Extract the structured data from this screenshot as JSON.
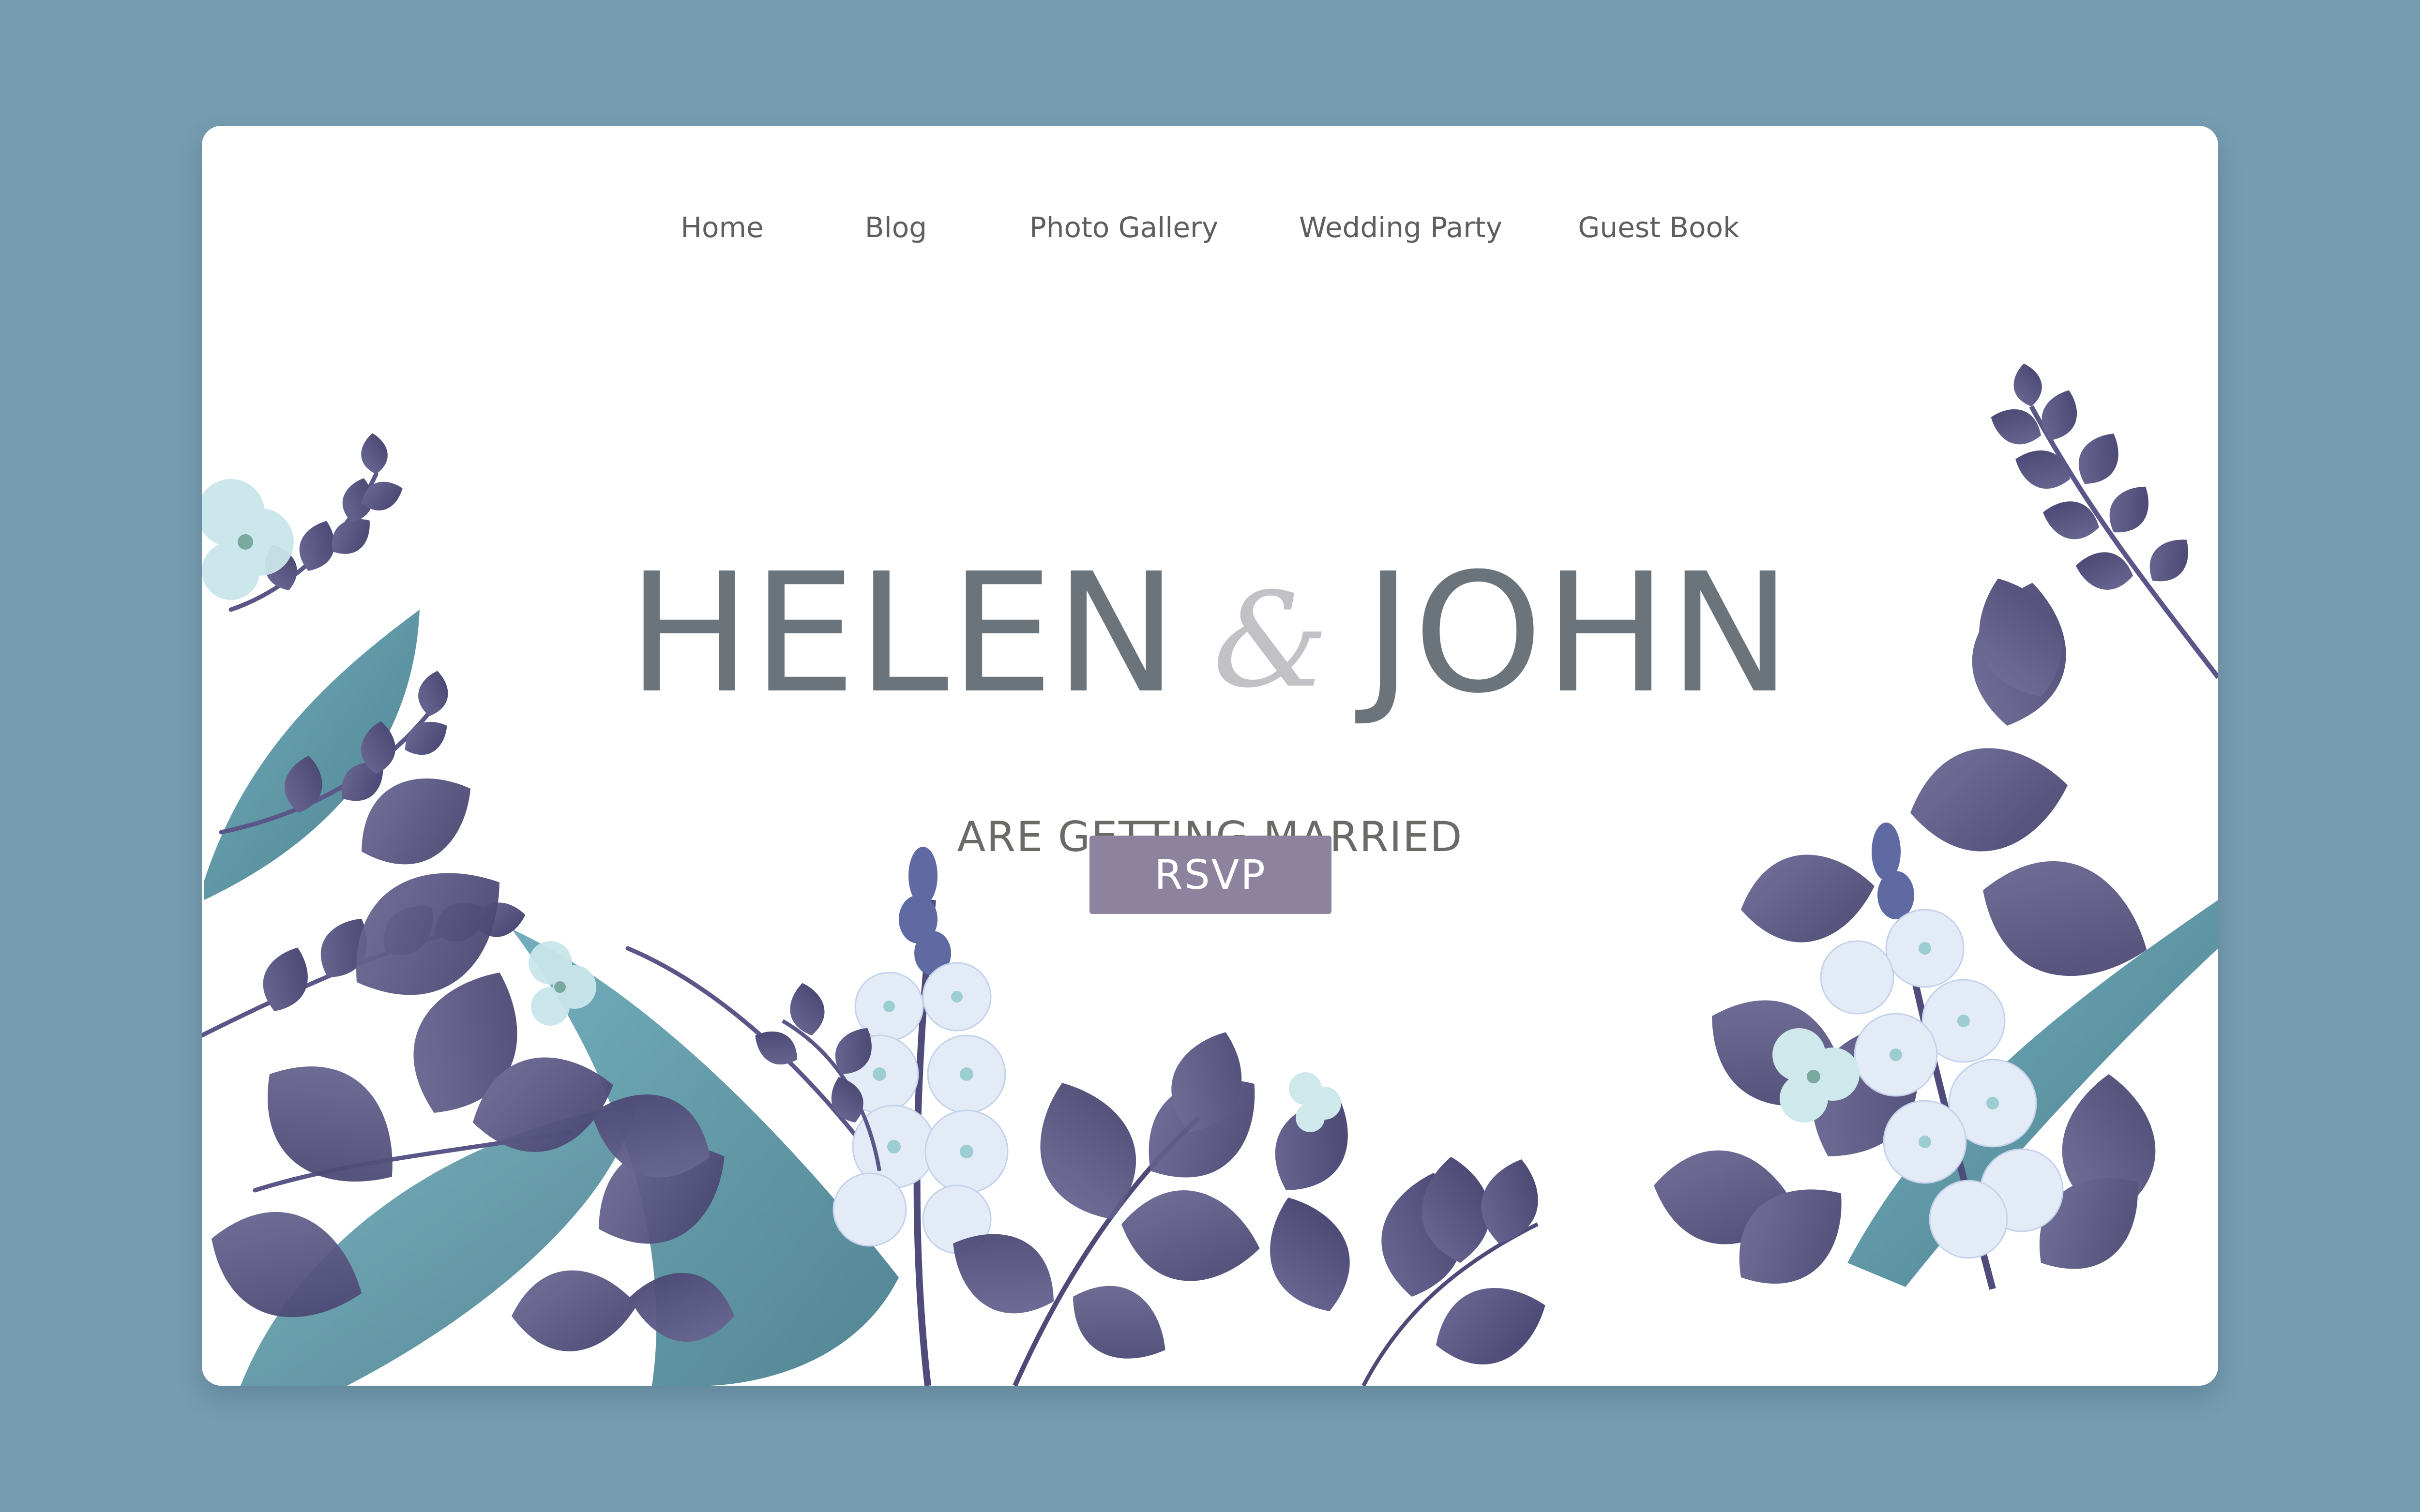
{
  "nav": {
    "items": [
      {
        "label": "Home"
      },
      {
        "label": "Blog"
      },
      {
        "label": "Photo Gallery"
      },
      {
        "label": "Wedding Party"
      },
      {
        "label": "Guest Book"
      }
    ]
  },
  "hero": {
    "name_one": "HELEN",
    "ampersand": "&",
    "name_two": "JOHN",
    "subtitle": "ARE GETTING MARRIED",
    "rsvp_label": "RSVP"
  },
  "colors": {
    "page_background": "#769cb0",
    "card_background": "#ffffff",
    "title_text": "#6a747a",
    "ampersand": "#c2c2c6",
    "button": "#8d839e",
    "leaf_purple": "#5e5b87",
    "leaf_teal": "#4f8fa0",
    "flower_white": "#e4ecf6"
  },
  "decoration": {
    "illustration": "watercolor-botanical-foliage"
  }
}
